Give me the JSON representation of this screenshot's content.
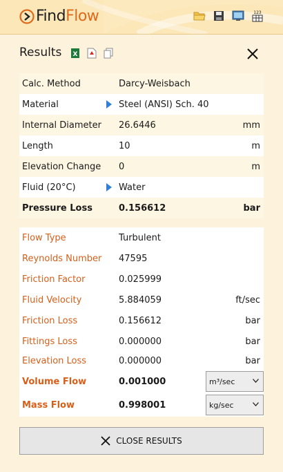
{
  "app": {
    "logo_find": "Find",
    "logo_flow": "Flow"
  },
  "toolbar": {
    "icons": [
      "open-folder-icon",
      "save-icon",
      "screen-icon",
      "calculator-123-icon"
    ],
    "calc_label": "123"
  },
  "results": {
    "title": "Results",
    "export_icons": [
      "excel-icon",
      "pdf-icon",
      "copy-icon"
    ]
  },
  "inputs": {
    "calc_method": {
      "label": "Calc. Method",
      "value": "Darcy-Weisbach",
      "unit": ""
    },
    "material": {
      "label": "Material",
      "value": "Steel (ANSI) Sch.  40",
      "unit": ""
    },
    "internal_diameter": {
      "label": "Internal Diameter",
      "value": "26.6446",
      "unit": "mm"
    },
    "length": {
      "label": "Length",
      "value": "10",
      "unit": "m"
    },
    "elevation_change": {
      "label": "Elevation Change",
      "value": "0",
      "unit": "m"
    },
    "fluid": {
      "label": "Fluid (20°C)",
      "value": "Water",
      "unit": ""
    },
    "pressure_loss": {
      "label": "Pressure Loss",
      "value": "0.156612",
      "unit": "bar"
    }
  },
  "outputs": {
    "flow_type": {
      "label": "Flow Type",
      "value": "Turbulent",
      "unit": ""
    },
    "reynolds": {
      "label": "Reynolds Number",
      "value": "47595",
      "unit": ""
    },
    "friction_factor": {
      "label": "Friction Factor",
      "value": "0.025999",
      "unit": ""
    },
    "fluid_velocity": {
      "label": "Fluid Velocity",
      "value": "5.884059",
      "unit": "ft/sec"
    },
    "friction_loss": {
      "label": "Friction Loss",
      "value": "0.156612",
      "unit": "bar"
    },
    "fittings_loss": {
      "label": "Fittings Loss",
      "value": "0.000000",
      "unit": "bar"
    },
    "elevation_loss": {
      "label": "Elevation Loss",
      "value": "0.000000",
      "unit": "bar"
    },
    "volume_flow": {
      "label": "Volume Flow",
      "value": "0.001000",
      "unit_selected": "m³/sec"
    },
    "mass_flow": {
      "label": "Mass Flow",
      "value": "0.998001",
      "unit_selected": "kg/sec"
    }
  },
  "close_button": {
    "label": "CLOSE RESULTS"
  },
  "colors": {
    "accent": "#e06a1c",
    "label_orange": "#d65f1a",
    "background": "#fdf3dc"
  }
}
